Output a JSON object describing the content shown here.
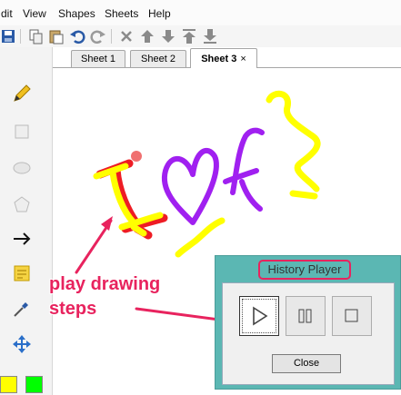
{
  "menubar": {
    "items": [
      {
        "label": "dit"
      },
      {
        "label": "View"
      },
      {
        "label": "Shapes"
      },
      {
        "label": "Sheets"
      },
      {
        "label": "Help"
      }
    ]
  },
  "toolbar": {
    "icons": [
      "save-icon",
      "copy-icon",
      "paste-icon",
      "undo-icon",
      "redo-icon",
      "delete-icon",
      "move-up-icon",
      "move-down-icon",
      "move-top-icon",
      "move-bottom-icon"
    ]
  },
  "tools": {
    "icons": [
      "pencil-icon",
      "rectangle-icon",
      "ellipse-icon",
      "polygon-icon",
      "arrow-icon",
      "sticky-note-icon",
      "color-picker-icon",
      "move-icon"
    ],
    "colors": {
      "primary": "#ffff00",
      "secondary": "#00ff00"
    }
  },
  "tabs": [
    {
      "label": "Sheet 1"
    },
    {
      "label": "Sheet 2"
    },
    {
      "label": "Sheet 3",
      "close": "×",
      "active": true
    }
  ],
  "canvas": {
    "stroke_colors": {
      "red": "#ee1c24",
      "yellow": "#ffff00",
      "purple": "#a020f0"
    }
  },
  "annotation": {
    "line1": "play drawing",
    "line2": "steps",
    "color": "#e8235e"
  },
  "history_player": {
    "title": "History Player",
    "buttons": {
      "play": "play-icon",
      "pause": "pause-icon",
      "stop": "stop-icon"
    },
    "close_label": "Close",
    "title_bar_color": "#5bb7b3"
  }
}
